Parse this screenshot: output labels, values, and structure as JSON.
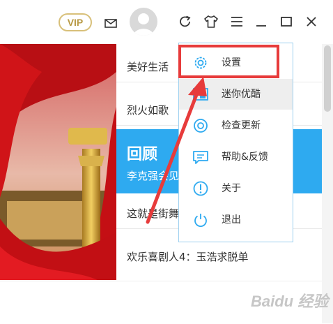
{
  "header": {
    "vip_label": "VIP",
    "icons": [
      "mail-icon",
      "avatar",
      "refresh-icon",
      "skin-icon",
      "menu-icon",
      "minimize-icon",
      "maximize-icon",
      "close-icon"
    ]
  },
  "list": {
    "items": [
      {
        "label": "美好生活"
      },
      {
        "label": "烈火如歌"
      },
      {
        "label": "这就是街舞"
      },
      {
        "label": "欢乐喜剧人4：玉浩求脱单"
      }
    ],
    "highlight": {
      "title": "回顾",
      "subtitle": "李克强会见"
    }
  },
  "menu": {
    "items": [
      {
        "label": "设置",
        "icon": "gear-icon"
      },
      {
        "label": "迷你优酷",
        "icon": "mini-window-icon"
      },
      {
        "label": "检查更新",
        "icon": "update-icon"
      },
      {
        "label": "帮助&反馈",
        "icon": "chat-icon"
      },
      {
        "label": "关于",
        "icon": "info-icon"
      },
      {
        "label": "退出",
        "icon": "power-icon"
      }
    ]
  },
  "annotation_color": "#e73b3b",
  "accent_color": "#2eaaf0",
  "watermark": "Baidu 经验"
}
